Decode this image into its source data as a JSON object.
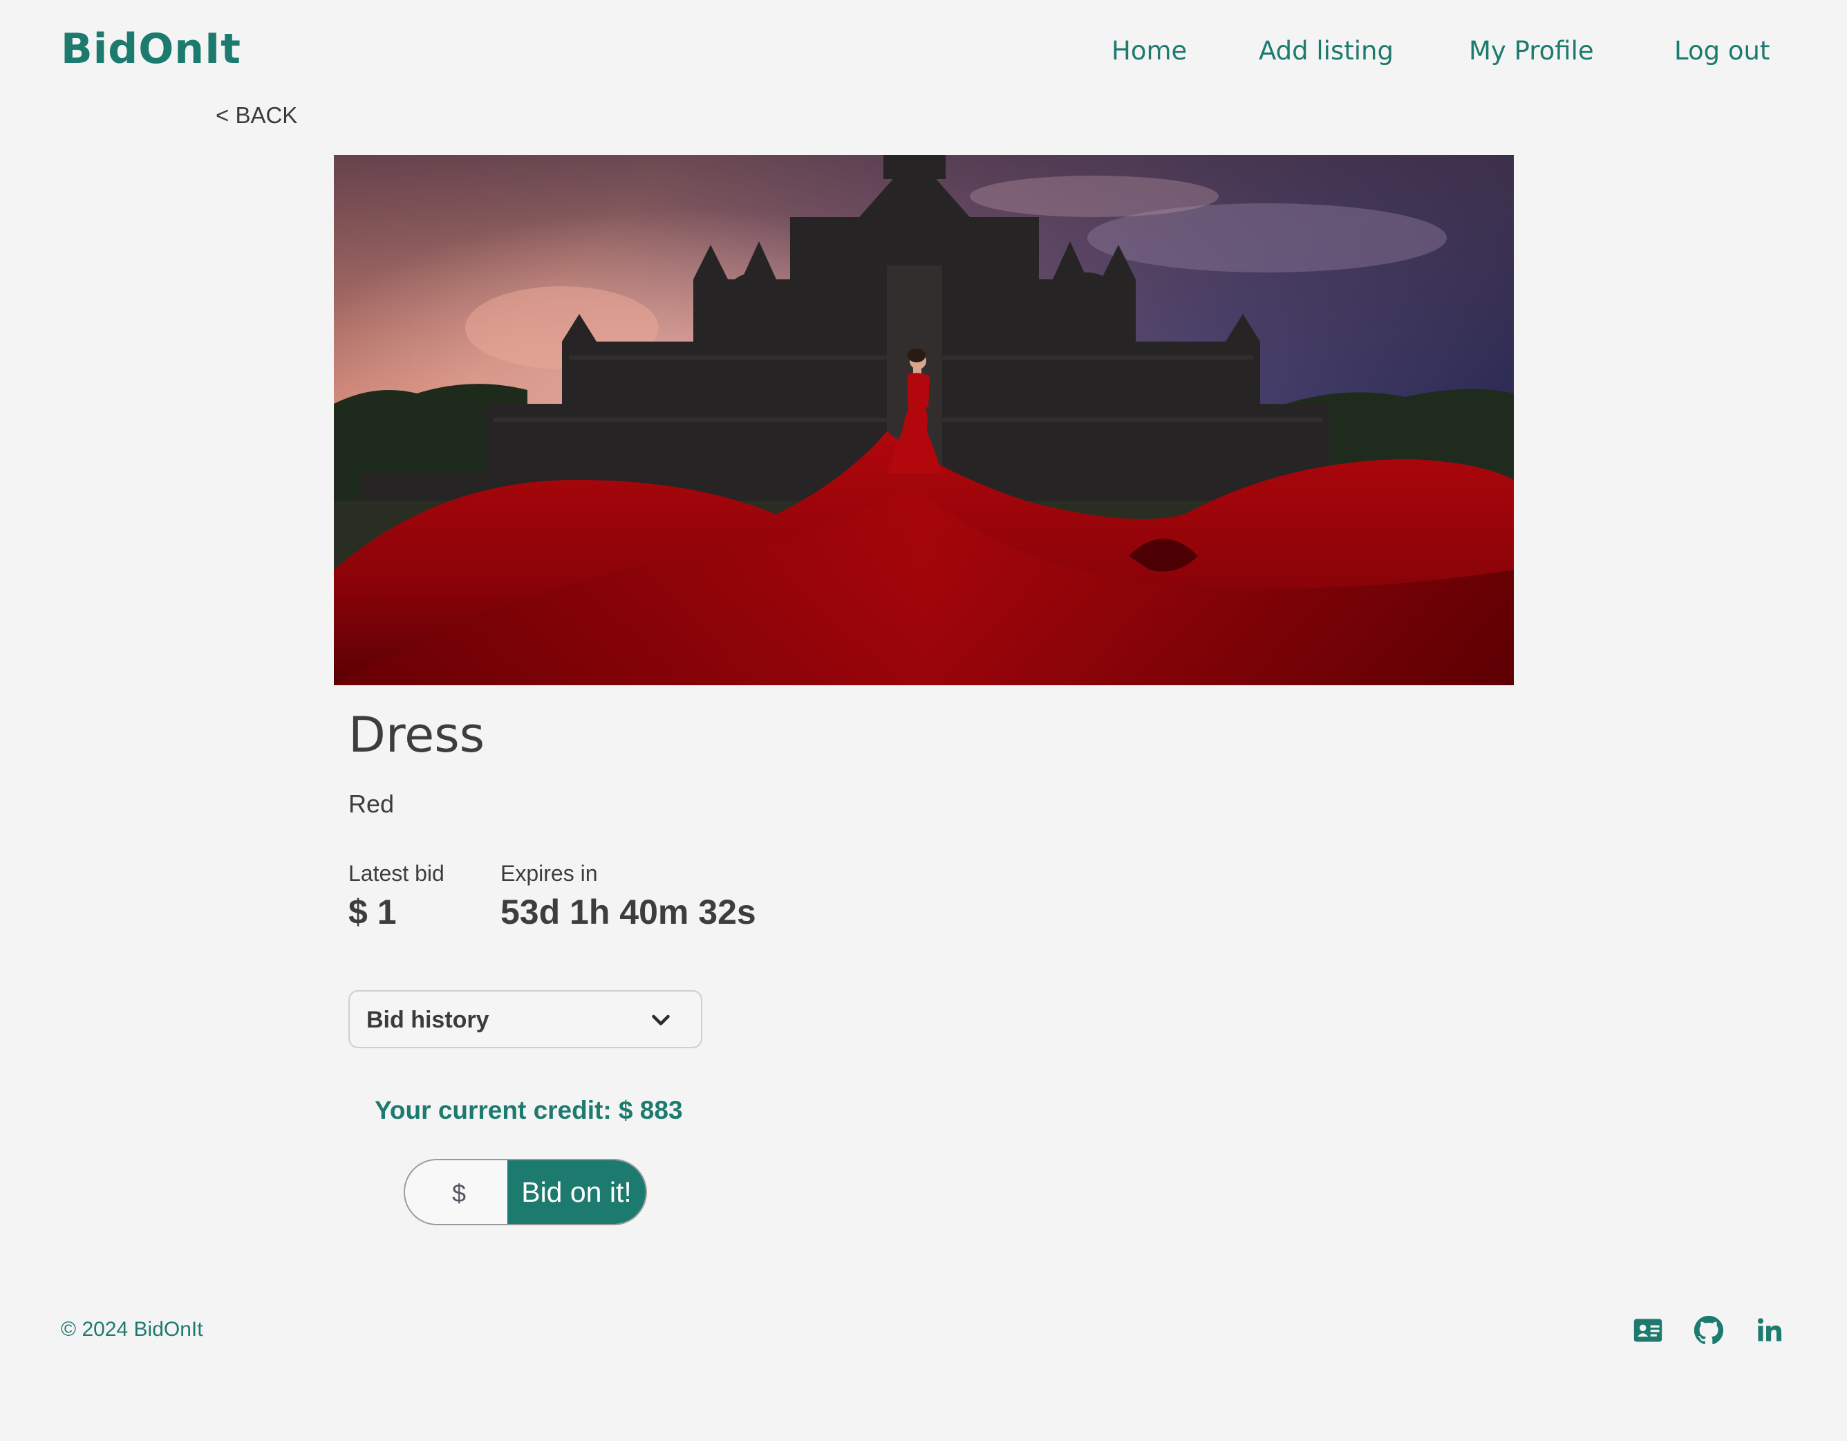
{
  "header": {
    "logo": "BidOnIt",
    "nav": {
      "home": "Home",
      "add_listing": "Add listing",
      "my_profile": "My Profile",
      "log_out": "Log out"
    }
  },
  "back_link": "< BACK",
  "listing": {
    "image_icon": "listing-photo",
    "title": "Dress",
    "description": "Red",
    "latest_bid_label": "Latest bid",
    "latest_bid_value": "$ 1",
    "expires_label": "Expires in",
    "expires_value": "53d 1h 40m 32s"
  },
  "bid_history": {
    "label": "Bid history"
  },
  "credit_text": "Your current credit: $ 883",
  "bid_form": {
    "placeholder": "$",
    "button_label": "Bid on it!"
  },
  "footer": {
    "copyright": "© 2024 BidOnIt",
    "icons": [
      "contact-card-icon",
      "github-icon",
      "linkedin-icon"
    ]
  },
  "colors": {
    "brand": "#1d7a6e",
    "background": "#f4f4f4",
    "text": "#3d3d3d"
  }
}
